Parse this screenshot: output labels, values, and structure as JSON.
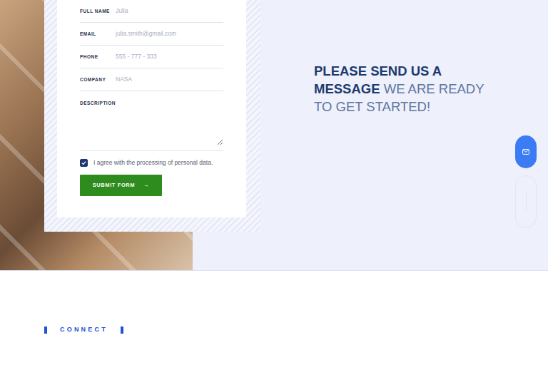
{
  "form": {
    "fields": [
      {
        "label": "FULL NAME",
        "placeholder": "Julia"
      },
      {
        "label": "EMAIL",
        "placeholder": "julia.smith@gmail.com"
      },
      {
        "label": "PHONE",
        "placeholder": "555 - 777 - 333"
      },
      {
        "label": "COMPANY",
        "placeholder": "NASA"
      }
    ],
    "description": {
      "label": "DESCRIPTION"
    },
    "consent": {
      "label": "I agree with the processing of personal data.",
      "checked": true
    },
    "submit": {
      "label": "SUBMIT FORM",
      "arrow": "→"
    }
  },
  "heading": {
    "strong": "PLEASE SEND US A MESSAGE",
    "light": "WE ARE READY TO GET STARTED!"
  },
  "connect": {
    "label": "CONNECT"
  }
}
